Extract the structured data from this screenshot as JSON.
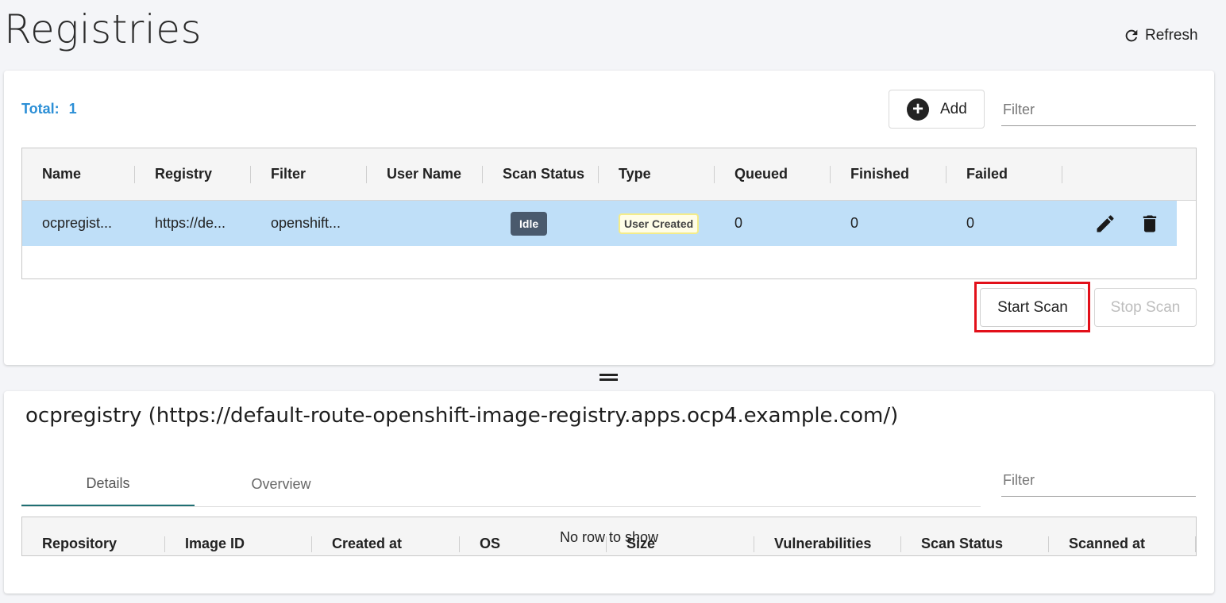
{
  "header": {
    "title": "Registries",
    "refresh_label": "Refresh"
  },
  "registries": {
    "total_label": "Total:",
    "total_value": "1",
    "add_label": "Add",
    "filter_placeholder": "Filter",
    "columns": [
      "Name",
      "Registry",
      "Filter",
      "User Name",
      "Scan Status",
      "Type",
      "Queued",
      "Finished",
      "Failed"
    ],
    "rows": [
      {
        "name": "ocpregist...",
        "registry": "https://de...",
        "filter": "openshift...",
        "user_name": "",
        "scan_status": "Idle",
        "type": "User Created",
        "queued": "0",
        "finished": "0",
        "failed": "0"
      }
    ],
    "start_scan_label": "Start Scan",
    "stop_scan_label": "Stop Scan"
  },
  "detail": {
    "title": "ocpregistry (https://default-route-openshift-image-registry.apps.ocp4.example.com/)",
    "tabs": [
      {
        "label": "Details",
        "active": true
      },
      {
        "label": "Overview",
        "active": false
      }
    ],
    "filter_placeholder": "Filter",
    "columns": [
      "Repository",
      "Image ID",
      "Created at",
      "OS",
      "Size",
      "Vulnerabilities",
      "Scan Status",
      "Scanned at"
    ],
    "empty_message": "No row to show"
  },
  "colors": {
    "accent_blue": "#2c8fd6",
    "selected_row": "#bfdff8",
    "highlight_red": "#e2101a",
    "idle_badge": "#4a5a6d",
    "tab_indicator": "#1f6f73"
  }
}
